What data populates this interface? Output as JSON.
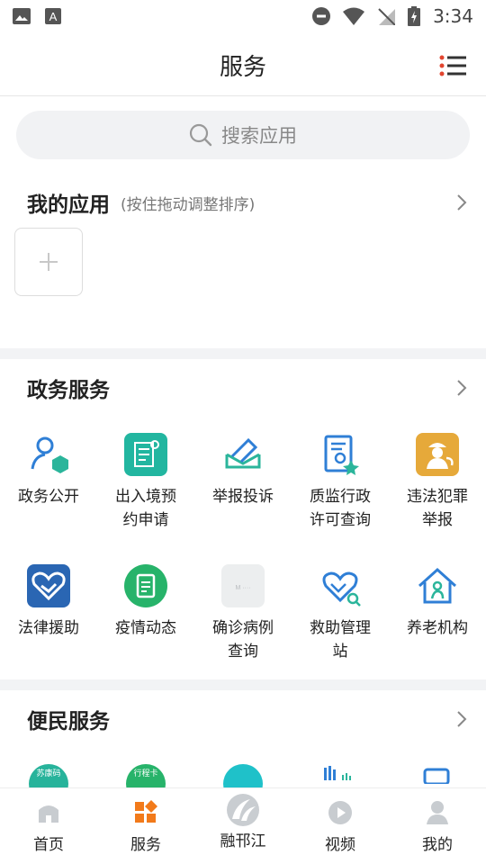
{
  "status_bar": {
    "time": "3:34"
  },
  "header": {
    "title": "服务"
  },
  "search": {
    "placeholder": "搜索应用"
  },
  "my_apps": {
    "title": "我的应用",
    "hint": "(按住拖动调整排序)"
  },
  "gov": {
    "title": "政务服务",
    "items": [
      {
        "label": "政务公开",
        "icon": "person-cube-icon"
      },
      {
        "label": "出入境预约申请",
        "icon": "passport-document-icon"
      },
      {
        "label": "举报投诉",
        "icon": "envelope-icon"
      },
      {
        "label": "质监行政许可查询",
        "icon": "certificate-search-icon"
      },
      {
        "label": "违法犯罪举报",
        "icon": "police-officer-icon"
      },
      {
        "label": "法律援助",
        "icon": "handshake-heart-icon"
      },
      {
        "label": "疫情动态",
        "icon": "report-icon"
      },
      {
        "label": "确诊病例查询",
        "icon": "case-query-icon"
      },
      {
        "label": "救助管理站",
        "icon": "helping-hand-icon"
      },
      {
        "label": "养老机构",
        "icon": "elderly-home-icon"
      }
    ]
  },
  "convenience": {
    "title": "便民服务",
    "partial_badges": [
      "苏康码",
      "行程卡"
    ]
  },
  "tabbar": {
    "items": [
      {
        "label": "首页",
        "icon": "home-icon"
      },
      {
        "label": "服务",
        "icon": "services-grid-icon",
        "active": true
      },
      {
        "label": "融邗江",
        "icon": "rong-hanjiang-logo"
      },
      {
        "label": "视频",
        "icon": "play-icon"
      },
      {
        "label": "我的",
        "icon": "profile-icon"
      }
    ]
  },
  "colors": {
    "accent": "#f27a1a",
    "teal": "#2bb59b",
    "blue": "#2f7fd6"
  }
}
